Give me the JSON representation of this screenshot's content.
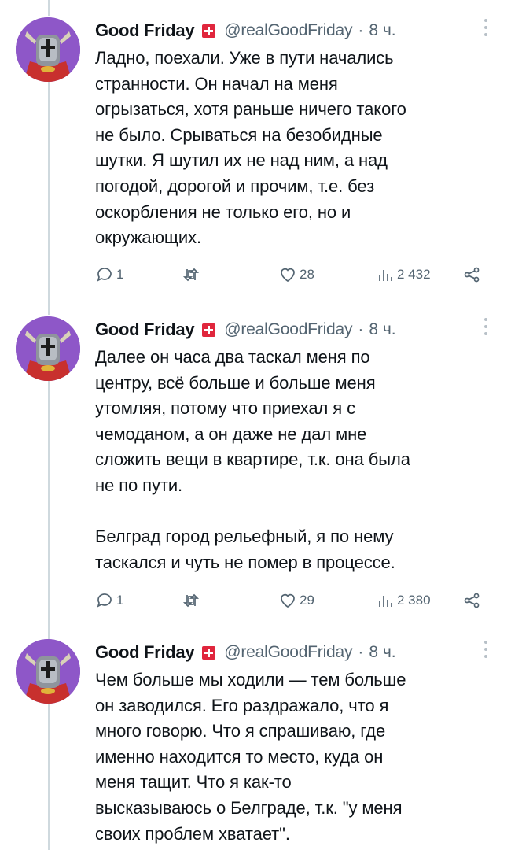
{
  "colors": {
    "avatar_bg": "#8e57c8",
    "badge": "#e0263d",
    "thread_line": "#cfd9de",
    "muted": "#536471"
  },
  "tweets": [
    {
      "author": "Good Friday",
      "handle": "@realGoodFriday",
      "separator": "·",
      "time": "8 ч.",
      "text": "Ладно, поехали. Уже в пути начались\nстранности. Он начал на меня\nогрызаться, хотя раньше ничего такого\nне было. Срываться на безобидные\nшутки. Я шутил их не над ним, а над\nпогодой, дорогой и прочим, т.е. без\nоскорбления не только его, но и\nокружающих.",
      "replies": "1",
      "likes": "28",
      "views": "2 432"
    },
    {
      "author": "Good Friday",
      "handle": "@realGoodFriday",
      "separator": "·",
      "time": "8 ч.",
      "text": "Далее он часа два таскал меня по\nцентру, всё больше и больше меня\nутомляя, потому что приехал я с\nчемоданом, а он даже не дал мне\nсложить вещи в квартире, т.к. она была\nне по пути.\n\nБелград город рельефный, я по нему\nтаскался и чуть не помер в процессе.",
      "replies": "1",
      "likes": "29",
      "views": "2 380"
    },
    {
      "author": "Good Friday",
      "handle": "@realGoodFriday",
      "separator": "·",
      "time": "8 ч.",
      "text": "Чем больше мы ходили — тем больше\nон заводился. Его раздражало, что я\nмного говорю. Что я спрашиваю, где\nименно находится то место, куда он\nменя тащит. Что я как-то\nвысказываюсь о Белграде, т.к. \"у меня\nсвоих проблем хватает\"."
    }
  ]
}
